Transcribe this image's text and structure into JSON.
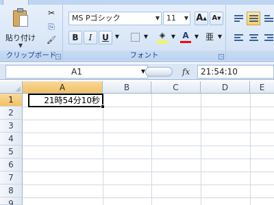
{
  "ribbon": {
    "clipboard": {
      "paste_label": "貼り付け",
      "group_label": "クリップボード",
      "tools": [
        {
          "name": "cut-icon",
          "glyph": "✂"
        },
        {
          "name": "copy-icon",
          "glyph": "⎘"
        },
        {
          "name": "format-painter-icon",
          "glyph": "🖌"
        }
      ]
    },
    "font": {
      "font_name": "MS Pゴシック",
      "font_size": "11",
      "grow_label": "A",
      "shrink_label": "A",
      "bold": "B",
      "italic": "I",
      "underline": "U",
      "font_color_label": "A",
      "phonetic_label": "亜",
      "group_label": "フォント",
      "fill_color": "#ffff00",
      "text_color": "#ff0000"
    }
  },
  "formula_bar": {
    "name_box": "A1",
    "fx": "fx",
    "formula": "21:54:10"
  },
  "sheet": {
    "columns": [
      "A",
      "B",
      "C",
      "D",
      "E"
    ],
    "rows": [
      "1",
      "2",
      "3",
      "4",
      "5",
      "6",
      "7",
      "8",
      "9"
    ],
    "cell_a1": "21時54分10秒"
  }
}
